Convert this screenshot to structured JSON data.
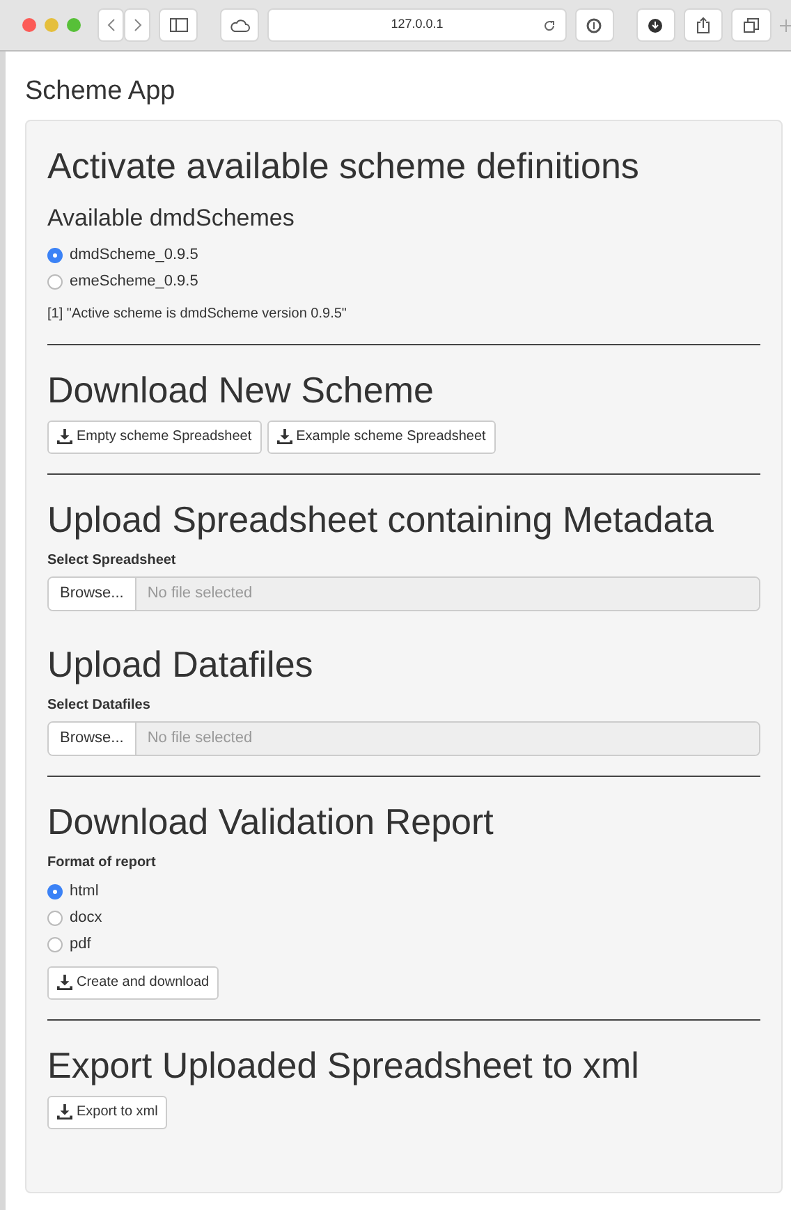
{
  "browser": {
    "url": "127.0.0.1"
  },
  "app_title": "Scheme App",
  "sections": [
    {
      "heading": "Activate available scheme definitions",
      "subheading": "Available dmdSchemes",
      "radios": [
        {
          "label": "dmdScheme_0.9.5",
          "selected": true
        },
        {
          "label": "emeScheme_0.9.5",
          "selected": false
        }
      ],
      "output": "[1] \"Active scheme is dmdScheme version 0.9.5\"",
      "divider_after": true
    },
    {
      "heading": "Download New Scheme",
      "buttons": [
        "Empty scheme Spreadsheet",
        "Example scheme Spreadsheet"
      ],
      "divider_after": true
    },
    {
      "heading": "Upload Spreadsheet containing Metadata",
      "label": "Select Spreadsheet",
      "file": {
        "button": "Browse...",
        "placeholder": "No file selected"
      },
      "divider_after": false
    },
    {
      "heading": "Upload Datafiles",
      "label": "Select Datafiles",
      "file": {
        "button": "Browse...",
        "placeholder": "No file selected"
      },
      "divider_after": true
    },
    {
      "heading": "Download Validation Report",
      "label": "Format of report",
      "radios": [
        {
          "label": "html",
          "selected": true
        },
        {
          "label": "docx",
          "selected": false
        },
        {
          "label": "pdf",
          "selected": false
        }
      ],
      "buttons": [
        "Create and download"
      ],
      "divider_after": true
    },
    {
      "heading": "Export Uploaded Spreadsheet to xml",
      "buttons": [
        "Export to xml"
      ],
      "divider_after": false
    }
  ]
}
